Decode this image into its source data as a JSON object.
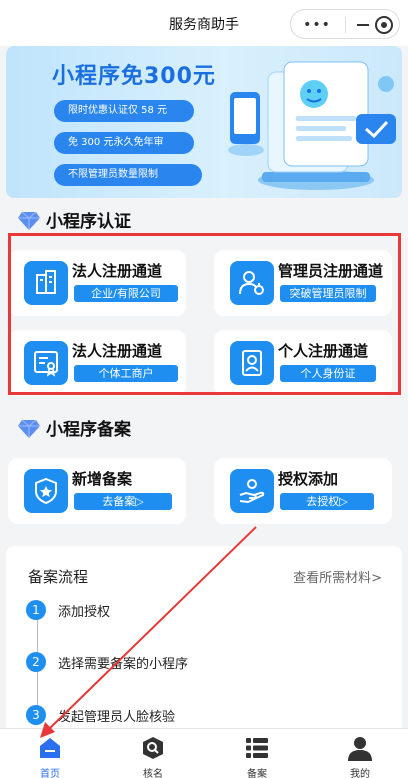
{
  "header": {
    "title": "服务商助手",
    "dots": "•••"
  },
  "banner": {
    "headline": "小程序免300元",
    "pills": [
      "限时优惠认证仅 58 元",
      "免 300 元永久免年审",
      "不限管理员数量限制"
    ]
  },
  "section1": {
    "title": "小程序认证"
  },
  "cards1": [
    {
      "name": "法人注册通道",
      "tag": "企业/有限公司",
      "icon": "building-icon"
    },
    {
      "name": "管理员注册通道",
      "tag": "突破管理员限制",
      "icon": "admin-user-icon"
    },
    {
      "name": "法人注册通道",
      "tag": "个体工商户",
      "icon": "certificate-icon"
    },
    {
      "name": "个人注册通道",
      "tag": "个人身份证",
      "icon": "id-card-icon"
    }
  ],
  "section2": {
    "title": "小程序备案"
  },
  "cards2": [
    {
      "name": "新增备案",
      "tag": "去备案▷",
      "icon": "shield-star-icon"
    },
    {
      "name": "授权添加",
      "tag": "去授权▷",
      "icon": "hand-auth-icon"
    }
  ],
  "process": {
    "title": "备案流程",
    "link": "查看所需材料>",
    "steps": [
      {
        "num": "1",
        "text": "添加授权"
      },
      {
        "num": "2",
        "text": "选择需要备案的小程序"
      },
      {
        "num": "3",
        "text": "发起管理员人脸核验"
      }
    ]
  },
  "tabs": [
    {
      "label": "首页",
      "icon": "home-icon",
      "active": true
    },
    {
      "label": "核名",
      "icon": "search-doc-icon",
      "active": false
    },
    {
      "label": "备案",
      "icon": "list-icon",
      "active": false
    },
    {
      "label": "我的",
      "icon": "person-icon",
      "active": false
    }
  ],
  "colors": {
    "accent": "#1e8ff0",
    "highlight": "#e83838",
    "activeTab": "#2a6ff0"
  }
}
